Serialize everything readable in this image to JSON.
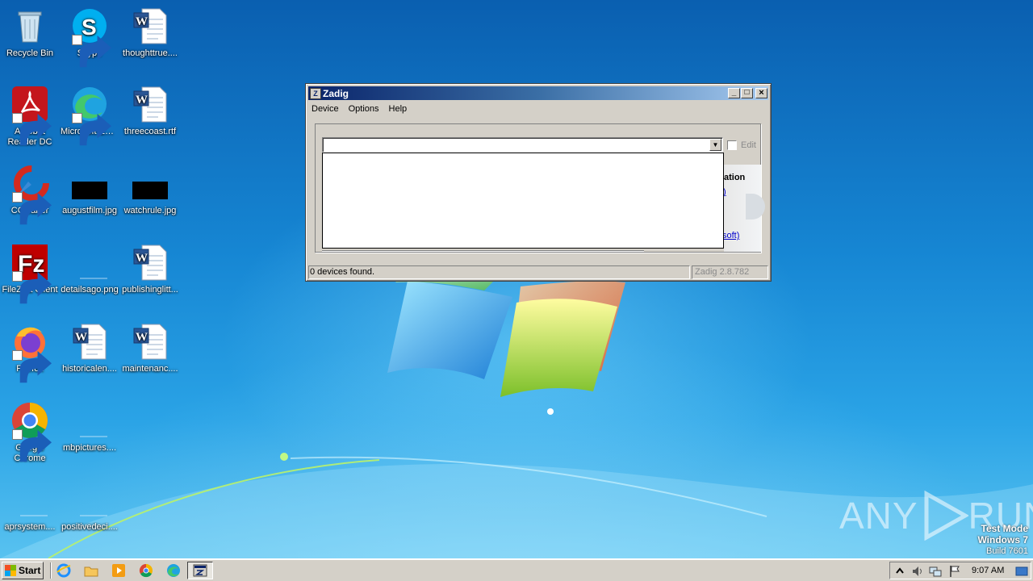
{
  "desktop": {
    "icons": [
      {
        "id": "recycle-bin",
        "label": "Recycle Bin"
      },
      {
        "id": "skype",
        "label": "Skype"
      },
      {
        "id": "thoughttrue",
        "label": "thoughttrue...."
      },
      {
        "id": "acrobat",
        "label": "Acrobat Reader DC"
      },
      {
        "id": "edge",
        "label": "Microsoft Edge"
      },
      {
        "id": "threecoast",
        "label": "threecoast.rtf"
      },
      {
        "id": "ccleaner",
        "label": "CCleaner"
      },
      {
        "id": "augustfilm",
        "label": "augustfilm.jpg"
      },
      {
        "id": "watchrule",
        "label": "watchrule.jpg"
      },
      {
        "id": "filezilla",
        "label": "FileZilla Client"
      },
      {
        "id": "detailsago",
        "label": "detailsago.png"
      },
      {
        "id": "publishinglitt",
        "label": "publishinglitt..."
      },
      {
        "id": "firefox",
        "label": "Firefox"
      },
      {
        "id": "historicalen",
        "label": "historicalen...."
      },
      {
        "id": "maintenanc",
        "label": "maintenanc...."
      },
      {
        "id": "chrome",
        "label": "Google Chrome"
      },
      {
        "id": "mbpictures",
        "label": "mbpictures...."
      },
      {
        "id": "aprsystem",
        "label": "aprsystem...."
      },
      {
        "id": "positivedeci",
        "label": "positivedeci...."
      }
    ],
    "watermark": {
      "left": "ANY",
      "right": "RUN"
    },
    "test_mode": {
      "line1": "Test Mode",
      "line2": "Windows 7",
      "line3": "Build 7601"
    }
  },
  "zadig": {
    "title": "Zadig",
    "menu": [
      "Device",
      "Options",
      "Help"
    ],
    "device_combo_value": "",
    "edit_label": "Edit",
    "info_heading": "ation",
    "info_link1": ")",
    "info_link2": "soft)",
    "status_left": "0 devices found.",
    "status_right": "Zadig 2.8.782"
  },
  "taskbar": {
    "start_label": "Start",
    "clock": "9:07 AM"
  },
  "colors": {
    "title_start": "#0a246a",
    "title_end": "#a6caf0",
    "chrome_face": "#d4d0c8",
    "desktop_blue": "#1779c9"
  }
}
